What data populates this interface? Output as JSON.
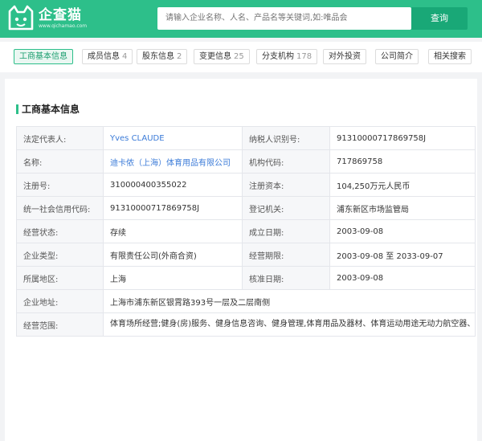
{
  "header": {
    "logo_name": "企查猫",
    "logo_domain": "www.qichamao.com",
    "search_placeholder": "请输入企业名称、人名、产品名等关键词,如:唯品会",
    "search_button": "查询",
    "brand_color": "#2dbf8a"
  },
  "tabs": [
    {
      "label": "工商基本信息",
      "count": "",
      "active": true
    },
    {
      "label": "成员信息",
      "count": "4"
    },
    {
      "label": "股东信息",
      "count": "2"
    },
    {
      "label": "变更信息",
      "count": "25"
    },
    {
      "label": "分支机构",
      "count": "178"
    },
    {
      "label": "对外投资",
      "count": ""
    },
    {
      "label": "公司简介",
      "count": ""
    },
    {
      "label": "相关搜索",
      "count": ""
    }
  ],
  "section": {
    "title": "工商基本信息"
  },
  "info": {
    "legal_rep_label": "法定代表人:",
    "legal_rep_value": "Yves CLAUDE",
    "taxpayer_label": "纳税人识别号:",
    "taxpayer_value": "91310000717869758J",
    "name_label": "名称:",
    "name_value": "迪卡侬（上海）体育用品有限公司",
    "org_code_label": "机构代码:",
    "org_code_value": "717869758",
    "reg_no_label": "注册号:",
    "reg_no_value": "310000400355022",
    "capital_label": "注册资本:",
    "capital_value": "104,250万元人民币",
    "credit_code_label": "统一社会信用代码:",
    "credit_code_value": "91310000717869758J",
    "authority_label": "登记机关:",
    "authority_value": "浦东新区市场监管局",
    "status_label": "经营状态:",
    "status_value": "存续",
    "founded_label": "成立日期:",
    "founded_value": "2003-09-08",
    "type_label": "企业类型:",
    "type_value": "有限责任公司(外商合资)",
    "term_label": "经营期限:",
    "term_value": "2003-09-08 至 2033-09-07",
    "region_label": "所属地区:",
    "region_value": "上海",
    "approved_label": "核准日期:",
    "approved_value": "2003-09-08",
    "address_label": "企业地址:",
    "address_value": "上海市浦东新区银霄路393号一层及二层南侧",
    "scope_label": "经营范围:",
    "scope_value": "体育场所经营;健身(房)服务、健身信息咨询、健身管理,体育用品及器材、体育运动用途无动力航空器、运动船和娱乐船及其装备,与运动相关的自行车及电动自行车、与运动相关的器材零部件和配套用品、日用百货、化妆品、针纺织品、服装鞋帽、五金及电子电器产品、仪器仪表、通讯产品(卫星地面接收设施除外)、计算机硬件和软件、钟表眼镜、厨房用具、户外装备、医疗器械(需凭《医疗器械经营企业许可证》经营的除外)、玩具、食品、饮料、营养品(涉及食品的限预包装食品(不含熟食卤味、冷冻冷藏))、动物用清洁剂及清洁用品、动物饲料的批发、零售、佣金代理(拍卖除外);商品进出口;计算机、软件及相关设备的维护及其他相关服务;经营相关的配套业务、售后服务和咨询服务;体育活动的组织和管理,体育设施和设备管理;部分承租商铺的出租;停车场(库)的经营;受母公司及其授权管理的中国境内外企业的委托,为其提供下列服务:市场信息咨询(市场调查除外);承接本公司集团内部的共享服务及境外公司的服务外包、员工培训与管理;自有设备的租赁。(不涉及国营贸易管理商品,涉及配额、许可证管理商品的,按国家有关规定办理申请;依法须经批准的项目,经相关部门批准后方可开展经营)。【依法须经批准的项目,经相关部门批准后方可开展经营活动】"
  }
}
